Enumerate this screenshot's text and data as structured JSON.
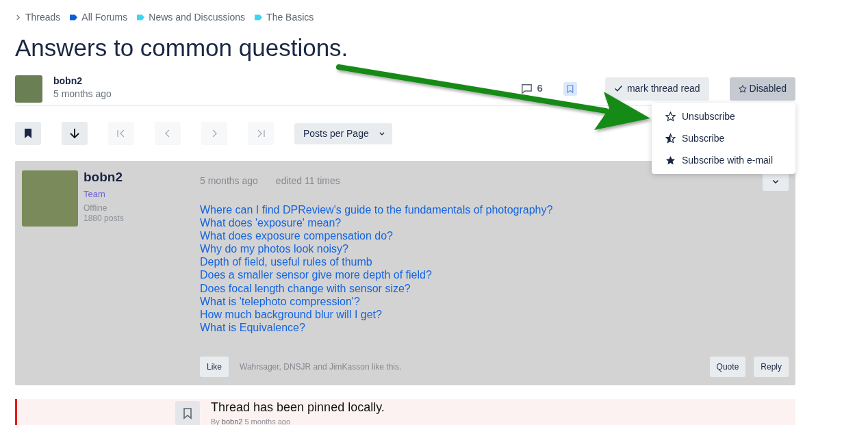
{
  "breadcrumbs": [
    {
      "label": "Threads",
      "kind": "chevron"
    },
    {
      "label": "All Forums",
      "kind": "tag",
      "color": "#0b5ed7"
    },
    {
      "label": "News and Discussions",
      "kind": "tag",
      "color": "#3dd5f3"
    },
    {
      "label": "The Basics",
      "kind": "tag",
      "color": "#3dd5f3"
    }
  ],
  "title": "Answers to common questions.",
  "thread_author": {
    "name": "bobn2",
    "time": "5 months ago"
  },
  "reply_count": "6",
  "mark_read_button": "mark thread read",
  "subscription_button": "Disabled",
  "subscription_menu": [
    {
      "label": "Unsubscribe",
      "kind": "empty"
    },
    {
      "label": "Subscribe",
      "kind": "half"
    },
    {
      "label": "Subscribe with e-mail",
      "kind": "full"
    }
  ],
  "toolbar": [
    {
      "kind": "bookmark",
      "disabled": false
    },
    {
      "kind": "down",
      "disabled": false
    },
    {
      "kind": "first",
      "disabled": true
    },
    {
      "kind": "prev",
      "disabled": true
    },
    {
      "kind": "next",
      "disabled": true
    },
    {
      "kind": "last",
      "disabled": true
    }
  ],
  "posts_per_page": "Posts per Page",
  "post": {
    "author": "bobn2",
    "role": "Team",
    "presence": "Offline",
    "post_count": "1880 posts",
    "time": "5 months ago",
    "edited": "edited 11 times",
    "links": [
      "Where can I find DPReview's guide to the fundamentals of photography?",
      "What does 'exposure' mean?",
      "What does exposure compensation do?",
      "Why do my photos look noisy?",
      "Depth of field, useful rules of thumb",
      "Does a smaller sensor give more depth of field?",
      "Does focal length change with sensor size?",
      "What is 'telephoto compression'?",
      "How much background blur will I get?",
      "What is Equivalence?"
    ],
    "like_button": "Like",
    "likes": "Wahrsager, DNSJR and JimKasson like this.",
    "quote_button": "Quote",
    "reply_button": "Reply"
  },
  "pinned_notice": {
    "title": "Thread has been pinned locally.",
    "by": "By",
    "author": "bobn2",
    "time": "5 months ago"
  }
}
